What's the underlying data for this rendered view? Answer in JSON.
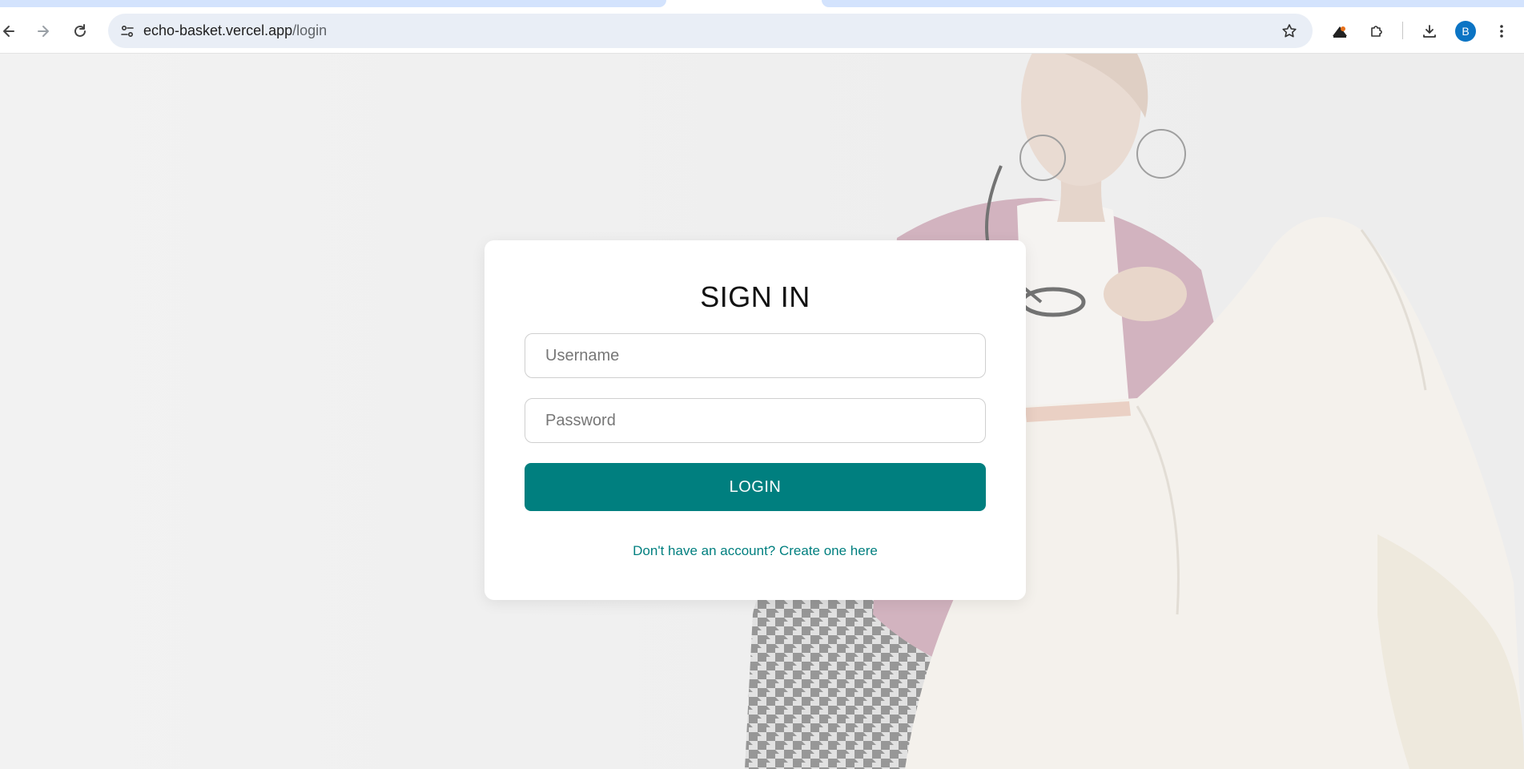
{
  "browser": {
    "url_host": "echo-basket.vercel.app",
    "url_path": "/login",
    "avatar_letter": "B",
    "icons": [
      "back-arrow-icon",
      "forward-arrow-icon",
      "reload-icon",
      "site-info-icon",
      "bookmark-star-icon",
      "extension-icon",
      "puzzle-icon",
      "download-icon",
      "more-vertical-icon"
    ]
  },
  "login": {
    "title": "SIGN IN",
    "username_placeholder": "Username",
    "password_placeholder": "Password",
    "login_label": "LOGIN",
    "signup_text": "Don't have an account? Create one here"
  },
  "colors": {
    "accent": "#007f7f",
    "omnibox": "#e9eef6",
    "tab_highlight": "#d3e3fd",
    "avatar": "#0b74c4"
  }
}
